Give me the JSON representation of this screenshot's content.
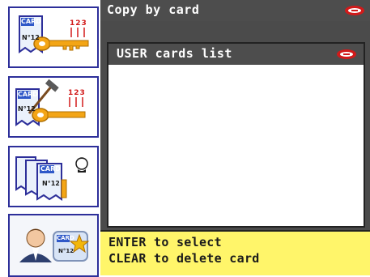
{
  "header": {
    "title": "Copy by card",
    "logo": "silca-logo-icon"
  },
  "panel": {
    "title": "USER cards list",
    "logo": "silca-logo-icon",
    "items": []
  },
  "sidebar": {
    "items": [
      {
        "name": "card-key-copy",
        "card_label": "CARD",
        "card_number": "N°12",
        "counter": "123"
      },
      {
        "name": "card-key-edit",
        "card_label": "CARD",
        "card_number": "N°12",
        "counter": "123"
      },
      {
        "name": "card-stack",
        "card_label": "CARD",
        "card_number": "N°12"
      },
      {
        "name": "user-card",
        "card_label": "CARD",
        "card_number": "N°12"
      }
    ]
  },
  "info": {
    "lines": [
      "ENTER to select",
      "CLEAR to delete card"
    ]
  },
  "colors": {
    "accent": "#2d2f9a",
    "bar": "#4d4d4d",
    "info_bg": "#fff56a",
    "logo_red": "#d21a1a"
  }
}
